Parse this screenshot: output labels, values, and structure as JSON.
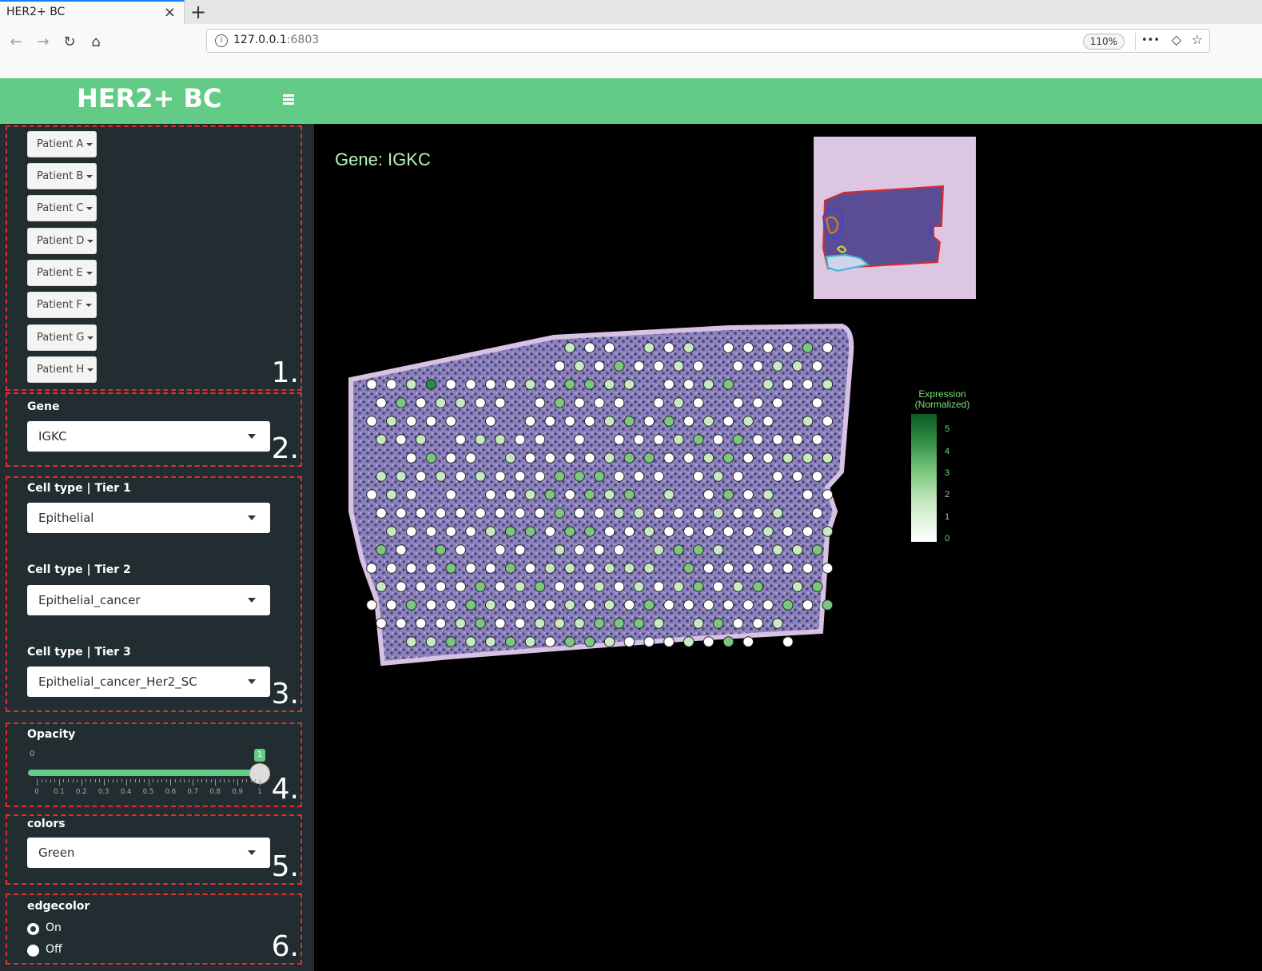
{
  "browser": {
    "tab_title": "HER2+ BC",
    "tab_close": "×",
    "new_tab": "+",
    "url_host": "127.0.0.1",
    "url_port": ":6803",
    "zoom": "110%",
    "menu_icon": "•••"
  },
  "header": {
    "title": "HER2+ BC"
  },
  "sidebar": {
    "patients": [
      "Patient A",
      "Patient B",
      "Patient C",
      "Patient D",
      "Patient E",
      "Patient F",
      "Patient G",
      "Patient H"
    ],
    "section_numbers": [
      "1.",
      "2.",
      "3.",
      "4.",
      "5.",
      "6."
    ],
    "gene": {
      "label": "Gene",
      "value": "IGKC"
    },
    "tier1": {
      "label": "Cell type | Tier 1",
      "value": "Epithelial"
    },
    "tier2": {
      "label": "Cell type | Tier 2",
      "value": "Epithelial_cancer"
    },
    "tier3": {
      "label": "Cell type | Tier 3",
      "value": "Epithelial_cancer_Her2_SC"
    },
    "opacity": {
      "label": "Opacity",
      "min_label": "0",
      "value": 1,
      "value_label": "1",
      "ticks": [
        "0",
        "0.1",
        "0.2",
        "0.3",
        "0.4",
        "0.5",
        "0.6",
        "0.7",
        "0.8",
        "0.9",
        "1"
      ]
    },
    "colors": {
      "label": "colors",
      "value": "Green"
    },
    "edgecolor": {
      "label": "edgecolor",
      "options": [
        "On",
        "Off"
      ],
      "selected": "On"
    }
  },
  "main": {
    "title": "Gene: IGKC",
    "legend": {
      "title_line1": "Expression",
      "title_line2": "(Normalized)",
      "labels": [
        "5",
        "4",
        "3",
        "2",
        "1",
        "0"
      ],
      "colors": [
        "#0c5a25",
        "#2e8a42",
        "#7cc67e",
        "#c8eac3",
        "#ffffff"
      ]
    }
  }
}
